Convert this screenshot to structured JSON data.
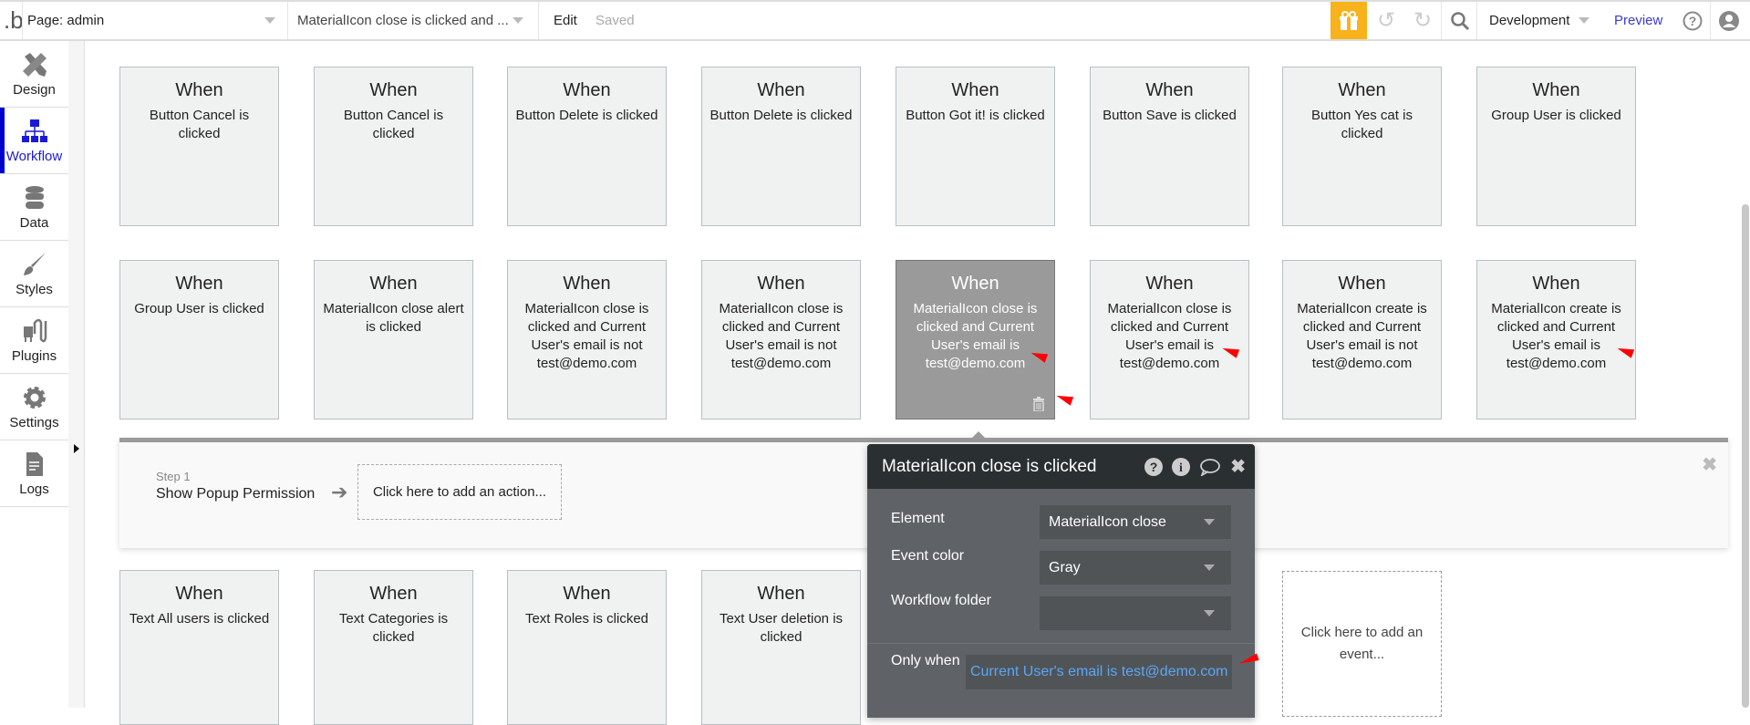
{
  "topbar": {
    "logo": ".b",
    "page": "Page: admin",
    "workflow": "MaterialIcon close is clicked and ...",
    "edit": "Edit",
    "saved": "Saved",
    "environment": "Development",
    "preview": "Preview"
  },
  "sidebar": {
    "items": [
      {
        "label": "Design"
      },
      {
        "label": "Workflow"
      },
      {
        "label": "Data"
      },
      {
        "label": "Styles"
      },
      {
        "label": "Plugins"
      },
      {
        "label": "Settings"
      },
      {
        "label": "Logs"
      }
    ]
  },
  "when": "When",
  "events": {
    "row1": [
      "Button Cancel is clicked",
      "Button Cancel is clicked",
      "Button Delete is clicked",
      "Button Delete is clicked",
      "Button Got it! is clicked",
      "Button Save is clicked",
      "Button Yes cat is clicked",
      "Group User is clicked"
    ],
    "row2": [
      "Group User is clicked",
      "MaterialIcon close alert is clicked",
      "MaterialIcon close is clicked and Current User's email is not test@demo.com",
      "MaterialIcon close is clicked and Current User's email is not test@demo.com",
      "MaterialIcon close is clicked and Current User's email is test@demo.com",
      "MaterialIcon close is clicked and Current User's email is test@demo.com",
      "MaterialIcon create is clicked and Current User's email is not test@demo.com",
      "MaterialIcon create is clicked and Current User's email is test@demo.com"
    ],
    "row3": [
      "Text All users is clicked",
      "Text Categories is clicked",
      "Text Roles is clicked",
      "Text User deletion is clicked"
    ],
    "add_event": "Click here to add an event..."
  },
  "step": {
    "label": "Step 1",
    "name": "Show Popup Permission",
    "add_action": "Click here to add an action..."
  },
  "popup": {
    "title": "MaterialIcon close is clicked",
    "element_label": "Element",
    "element_value": "MaterialIcon close",
    "color_label": "Event color",
    "color_value": "Gray",
    "folder_label": "Workflow folder",
    "folder_value": "",
    "only_when_label": "Only when",
    "only_when_value": "Current User's email is test@demo.com"
  },
  "colors": {
    "accent": "#1a1ad6",
    "gift": "#f8b21b",
    "selected_card": "#9a9a9a",
    "condition": "#5aa7f5"
  }
}
